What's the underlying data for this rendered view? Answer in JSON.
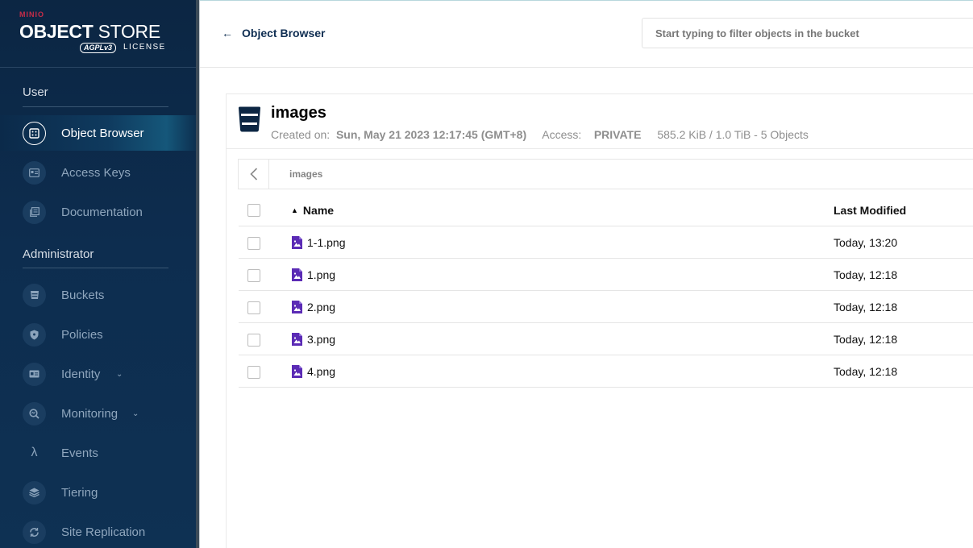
{
  "sidebar": {
    "logo": {
      "brand": "MINIO",
      "title_bold": "OBJECT",
      "title_rest": "STORE",
      "badge": "AGPLv3",
      "license": "LICENSE"
    },
    "sections": [
      {
        "label": "User",
        "items": [
          {
            "label": "Object Browser",
            "icon": "object-browser-icon",
            "active": true
          },
          {
            "label": "Access Keys",
            "icon": "access-keys-icon"
          },
          {
            "label": "Documentation",
            "icon": "documentation-icon"
          }
        ]
      },
      {
        "label": "Administrator",
        "items": [
          {
            "label": "Buckets",
            "icon": "bucket-icon"
          },
          {
            "label": "Policies",
            "icon": "shield-icon"
          },
          {
            "label": "Identity",
            "icon": "identity-icon",
            "expandable": true
          },
          {
            "label": "Monitoring",
            "icon": "monitoring-icon",
            "expandable": true
          },
          {
            "label": "Events",
            "icon": "lambda-icon"
          },
          {
            "label": "Tiering",
            "icon": "layers-icon"
          },
          {
            "label": "Site Replication",
            "icon": "sync-icon"
          }
        ]
      }
    ]
  },
  "header": {
    "back_label": "Object Browser",
    "filter_placeholder": "Start typing to filter objects in the bucket"
  },
  "bucket": {
    "name": "images",
    "created_label": "Created on:",
    "created_value": "Sun, May 21 2023 12:17:45 (GMT+8)",
    "access_label": "Access:",
    "access_value": "PRIVATE",
    "usage": "585.2 KiB / 1.0 TiB - 5 Objects"
  },
  "breadcrumb": {
    "path": "images"
  },
  "table": {
    "columns": {
      "name": "Name",
      "modified": "Last Modified"
    },
    "rows": [
      {
        "name": "1-1.png",
        "modified": "Today, 13:20"
      },
      {
        "name": "1.png",
        "modified": "Today, 12:18"
      },
      {
        "name": "2.png",
        "modified": "Today, 12:18"
      },
      {
        "name": "3.png",
        "modified": "Today, 12:18"
      },
      {
        "name": "4.png",
        "modified": "Today, 12:18"
      }
    ]
  },
  "colors": {
    "sidebar_bg": "#0c2643",
    "accent": "#0f2e52",
    "file_icon": "#5b2bb5"
  }
}
